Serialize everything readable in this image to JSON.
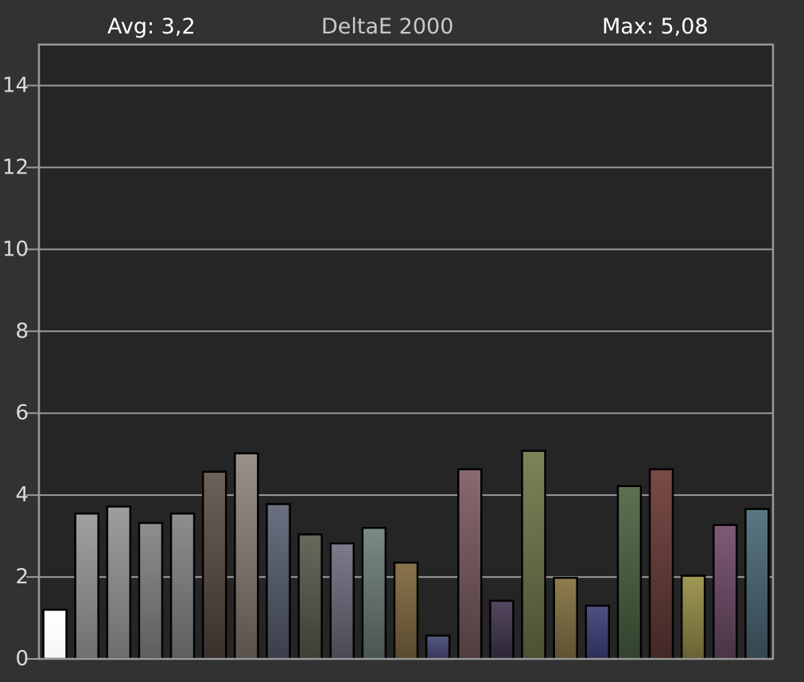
{
  "chart_data": {
    "type": "bar",
    "title": "DeltaE 2000",
    "avg_label": "Avg: 3,2",
    "max_label": "Max: 5,08",
    "xlabel": "",
    "ylabel": "",
    "ylim": [
      0,
      15
    ],
    "yticks": [
      0,
      2,
      4,
      6,
      8,
      10,
      12,
      14
    ],
    "grid": true,
    "legend": "none",
    "values": [
      1.2,
      3.55,
      3.72,
      3.32,
      3.55,
      4.57,
      5.02,
      3.78,
      3.04,
      2.82,
      3.2,
      2.35,
      0.57,
      4.63,
      1.42,
      5.08,
      1.98,
      1.3,
      4.22,
      4.63,
      2.03,
      3.27,
      3.66
    ],
    "bar_colors": [
      [
        "#f6f6f6",
        "#ffffff"
      ],
      [
        "#707070",
        "#a0a0a0"
      ],
      [
        "#6e6e6e",
        "#9e9e9e"
      ],
      [
        "#5e5e5e",
        "#8e8e8e"
      ],
      [
        "#5e5e5e",
        "#8e8e8e"
      ],
      [
        "#3a312c",
        "#6d6259"
      ],
      [
        "#5a534d",
        "#9a918a"
      ],
      [
        "#3a3f4a",
        "#6a7080"
      ],
      [
        "#3d3f35",
        "#666a5b"
      ],
      [
        "#4b4955",
        "#7d7a8a"
      ],
      [
        "#4a5552",
        "#7b8a85"
      ],
      [
        "#5a4b2e",
        "#8a744c"
      ],
      [
        "#36365c",
        "#565880"
      ],
      [
        "#4f3d40",
        "#8a6a6e"
      ],
      [
        "#2d2635",
        "#54475e"
      ],
      [
        "#4c5134",
        "#7d8458"
      ],
      [
        "#5e5232",
        "#8f7d4f"
      ],
      [
        "#2e2e5a",
        "#4f4f85"
      ],
      [
        "#33432e",
        "#5c7252"
      ],
      [
        "#422826",
        "#7a4b47"
      ],
      [
        "#686234",
        "#a19955"
      ],
      [
        "#4a3446",
        "#7e5a76"
      ],
      [
        "#344650",
        "#5b7784"
      ]
    ],
    "colors": {
      "background": "#323232",
      "plot": "#252525",
      "grid": "#9a9a9a",
      "axis_text": "#dcdcdc",
      "bar_edge": "#000000"
    }
  }
}
